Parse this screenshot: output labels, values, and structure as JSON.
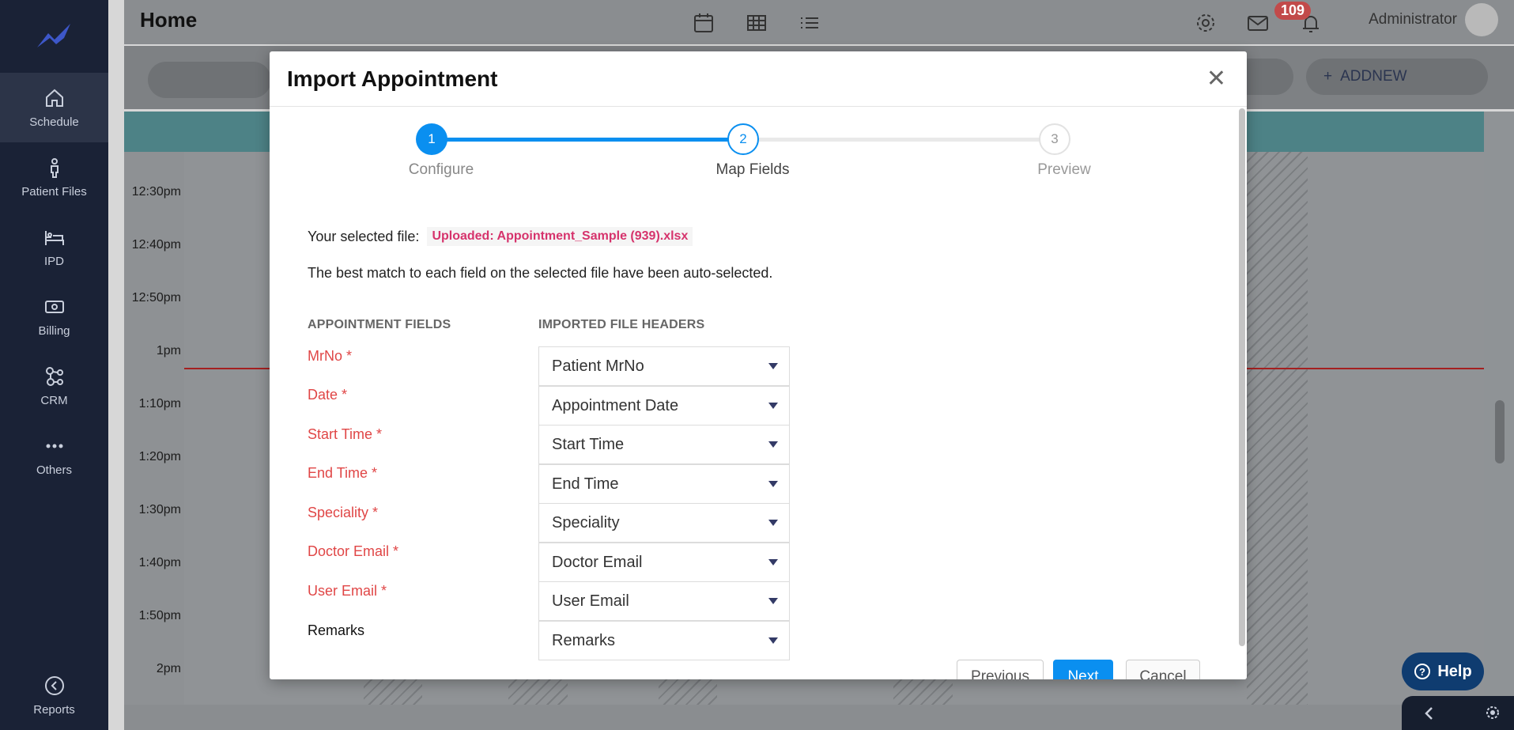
{
  "sidebar": {
    "items": [
      {
        "label": "Schedule",
        "icon": "home-icon"
      },
      {
        "label": "Patient Files",
        "icon": "person-icon"
      },
      {
        "label": "IPD",
        "icon": "bed-icon"
      },
      {
        "label": "Billing",
        "icon": "cash-icon"
      },
      {
        "label": "CRM",
        "icon": "network-icon"
      },
      {
        "label": "Others",
        "icon": "more-icon"
      }
    ],
    "reports_label": "Reports"
  },
  "header": {
    "title": "Home",
    "notification_count": "109",
    "user_name": "Administrator"
  },
  "toolbar": {
    "add_new_label": "ADDNEW"
  },
  "schedule": {
    "times": [
      "12:30pm",
      "12:40pm",
      "12:50pm",
      "1pm",
      "1:10pm",
      "1:20pm",
      "1:30pm",
      "1:40pm",
      "1:50pm",
      "2pm"
    ]
  },
  "help": {
    "label": "Help"
  },
  "modal": {
    "title": "Import Appointment",
    "steps": [
      {
        "number": "1",
        "label": "Configure",
        "state": "complete"
      },
      {
        "number": "2",
        "label": "Map Fields",
        "state": "active"
      },
      {
        "number": "3",
        "label": "Preview",
        "state": "pending"
      }
    ],
    "file_prefix": "Your selected file:",
    "file_name": "Uploaded: Appointment_Sample (939).xlsx",
    "note": "The best match to each field on the selected file have been auto-selected.",
    "col_fields": "APPOINTMENT FIELDS",
    "col_headers": "IMPORTED FILE HEADERS",
    "mappings": [
      {
        "field": "MrNo *",
        "header": "Patient MrNo",
        "required": true
      },
      {
        "field": "Date *",
        "header": "Appointment Date",
        "required": true
      },
      {
        "field": "Start Time *",
        "header": "Start Time",
        "required": true
      },
      {
        "field": "End Time *",
        "header": "End Time",
        "required": true
      },
      {
        "field": "Speciality *",
        "header": "Speciality",
        "required": true
      },
      {
        "field": "Doctor Email *",
        "header": "Doctor Email",
        "required": true
      },
      {
        "field": "User Email *",
        "header": "User Email",
        "required": true
      },
      {
        "field": "Remarks",
        "header": "Remarks",
        "required": false
      }
    ],
    "buttons": {
      "previous": "Previous",
      "next": "Next",
      "cancel": "Cancel"
    }
  },
  "colors": {
    "accent": "#0a8ff0",
    "required": "#e04646",
    "sidebar": "#1a2236"
  }
}
